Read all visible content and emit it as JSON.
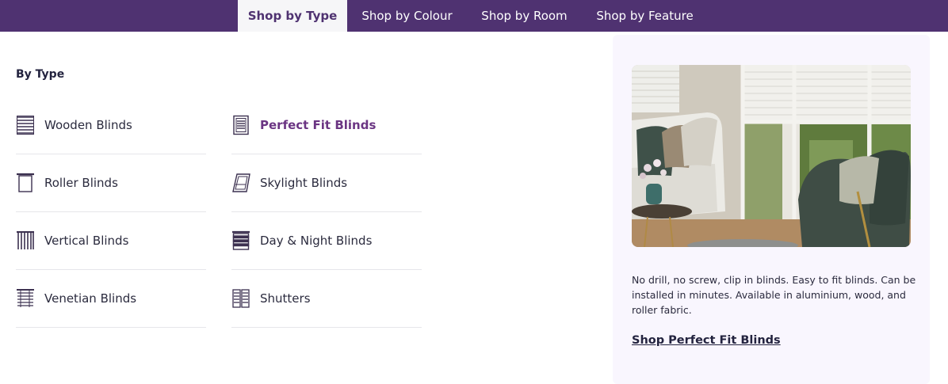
{
  "nav": {
    "tabs": [
      {
        "label": "Shop by Type",
        "active": true
      },
      {
        "label": "Shop by Colour",
        "active": false
      },
      {
        "label": "Shop by Room",
        "active": false
      },
      {
        "label": "Shop by Feature",
        "active": false
      }
    ]
  },
  "menu": {
    "heading": "By Type",
    "items": [
      {
        "label": "Wooden Blinds",
        "icon": "wooden-blinds-icon"
      },
      {
        "label": "Perfect Fit Blinds",
        "icon": "perfect-fit-blinds-icon",
        "highlighted": true
      },
      {
        "label": "Roller Blinds",
        "icon": "roller-blinds-icon"
      },
      {
        "label": "Skylight Blinds",
        "icon": "skylight-blinds-icon"
      },
      {
        "label": "Vertical Blinds",
        "icon": "vertical-blinds-icon"
      },
      {
        "label": "Day & Night Blinds",
        "icon": "day-night-blinds-icon"
      },
      {
        "label": "Venetian Blinds",
        "icon": "venetian-blinds-icon"
      },
      {
        "label": "Shutters",
        "icon": "shutters-icon"
      }
    ]
  },
  "promo": {
    "image": "living-room-photo",
    "text": "No drill, no screw, clip in blinds. Easy to fit blinds. Can be installed in minutes. Available in aluminium, wood, and roller fabric.",
    "link_label": "Shop Perfect Fit Blinds"
  },
  "colors": {
    "nav_background": "#4f3271",
    "highlight": "#6b3583",
    "promo_background": "#f9f6fe",
    "text": "#23233f"
  }
}
